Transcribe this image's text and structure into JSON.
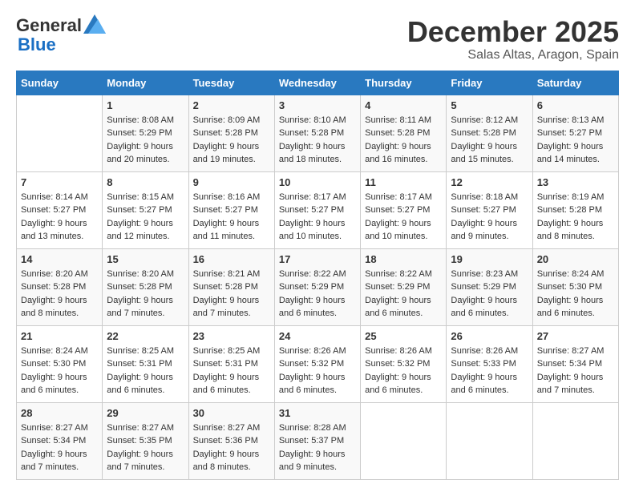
{
  "header": {
    "logo_general": "General",
    "logo_blue": "Blue",
    "month": "December 2025",
    "location": "Salas Altas, Aragon, Spain"
  },
  "days_of_week": [
    "Sunday",
    "Monday",
    "Tuesday",
    "Wednesday",
    "Thursday",
    "Friday",
    "Saturday"
  ],
  "weeks": [
    [
      {
        "day": "",
        "info": ""
      },
      {
        "day": "1",
        "info": "Sunrise: 8:08 AM\nSunset: 5:29 PM\nDaylight: 9 hours\nand 20 minutes."
      },
      {
        "day": "2",
        "info": "Sunrise: 8:09 AM\nSunset: 5:28 PM\nDaylight: 9 hours\nand 19 minutes."
      },
      {
        "day": "3",
        "info": "Sunrise: 8:10 AM\nSunset: 5:28 PM\nDaylight: 9 hours\nand 18 minutes."
      },
      {
        "day": "4",
        "info": "Sunrise: 8:11 AM\nSunset: 5:28 PM\nDaylight: 9 hours\nand 16 minutes."
      },
      {
        "day": "5",
        "info": "Sunrise: 8:12 AM\nSunset: 5:28 PM\nDaylight: 9 hours\nand 15 minutes."
      },
      {
        "day": "6",
        "info": "Sunrise: 8:13 AM\nSunset: 5:27 PM\nDaylight: 9 hours\nand 14 minutes."
      }
    ],
    [
      {
        "day": "7",
        "info": "Sunrise: 8:14 AM\nSunset: 5:27 PM\nDaylight: 9 hours\nand 13 minutes."
      },
      {
        "day": "8",
        "info": "Sunrise: 8:15 AM\nSunset: 5:27 PM\nDaylight: 9 hours\nand 12 minutes."
      },
      {
        "day": "9",
        "info": "Sunrise: 8:16 AM\nSunset: 5:27 PM\nDaylight: 9 hours\nand 11 minutes."
      },
      {
        "day": "10",
        "info": "Sunrise: 8:17 AM\nSunset: 5:27 PM\nDaylight: 9 hours\nand 10 minutes."
      },
      {
        "day": "11",
        "info": "Sunrise: 8:17 AM\nSunset: 5:27 PM\nDaylight: 9 hours\nand 10 minutes."
      },
      {
        "day": "12",
        "info": "Sunrise: 8:18 AM\nSunset: 5:27 PM\nDaylight: 9 hours\nand 9 minutes."
      },
      {
        "day": "13",
        "info": "Sunrise: 8:19 AM\nSunset: 5:28 PM\nDaylight: 9 hours\nand 8 minutes."
      }
    ],
    [
      {
        "day": "14",
        "info": "Sunrise: 8:20 AM\nSunset: 5:28 PM\nDaylight: 9 hours\nand 8 minutes."
      },
      {
        "day": "15",
        "info": "Sunrise: 8:20 AM\nSunset: 5:28 PM\nDaylight: 9 hours\nand 7 minutes."
      },
      {
        "day": "16",
        "info": "Sunrise: 8:21 AM\nSunset: 5:28 PM\nDaylight: 9 hours\nand 7 minutes."
      },
      {
        "day": "17",
        "info": "Sunrise: 8:22 AM\nSunset: 5:29 PM\nDaylight: 9 hours\nand 6 minutes."
      },
      {
        "day": "18",
        "info": "Sunrise: 8:22 AM\nSunset: 5:29 PM\nDaylight: 9 hours\nand 6 minutes."
      },
      {
        "day": "19",
        "info": "Sunrise: 8:23 AM\nSunset: 5:29 PM\nDaylight: 9 hours\nand 6 minutes."
      },
      {
        "day": "20",
        "info": "Sunrise: 8:24 AM\nSunset: 5:30 PM\nDaylight: 9 hours\nand 6 minutes."
      }
    ],
    [
      {
        "day": "21",
        "info": "Sunrise: 8:24 AM\nSunset: 5:30 PM\nDaylight: 9 hours\nand 6 minutes."
      },
      {
        "day": "22",
        "info": "Sunrise: 8:25 AM\nSunset: 5:31 PM\nDaylight: 9 hours\nand 6 minutes."
      },
      {
        "day": "23",
        "info": "Sunrise: 8:25 AM\nSunset: 5:31 PM\nDaylight: 9 hours\nand 6 minutes."
      },
      {
        "day": "24",
        "info": "Sunrise: 8:26 AM\nSunset: 5:32 PM\nDaylight: 9 hours\nand 6 minutes."
      },
      {
        "day": "25",
        "info": "Sunrise: 8:26 AM\nSunset: 5:32 PM\nDaylight: 9 hours\nand 6 minutes."
      },
      {
        "day": "26",
        "info": "Sunrise: 8:26 AM\nSunset: 5:33 PM\nDaylight: 9 hours\nand 6 minutes."
      },
      {
        "day": "27",
        "info": "Sunrise: 8:27 AM\nSunset: 5:34 PM\nDaylight: 9 hours\nand 7 minutes."
      }
    ],
    [
      {
        "day": "28",
        "info": "Sunrise: 8:27 AM\nSunset: 5:34 PM\nDaylight: 9 hours\nand 7 minutes."
      },
      {
        "day": "29",
        "info": "Sunrise: 8:27 AM\nSunset: 5:35 PM\nDaylight: 9 hours\nand 7 minutes."
      },
      {
        "day": "30",
        "info": "Sunrise: 8:27 AM\nSunset: 5:36 PM\nDaylight: 9 hours\nand 8 minutes."
      },
      {
        "day": "31",
        "info": "Sunrise: 8:28 AM\nSunset: 5:37 PM\nDaylight: 9 hours\nand 9 minutes."
      },
      {
        "day": "",
        "info": ""
      },
      {
        "day": "",
        "info": ""
      },
      {
        "day": "",
        "info": ""
      }
    ]
  ],
  "colors": {
    "header_bg": "#2979c0",
    "header_text": "#ffffff"
  }
}
